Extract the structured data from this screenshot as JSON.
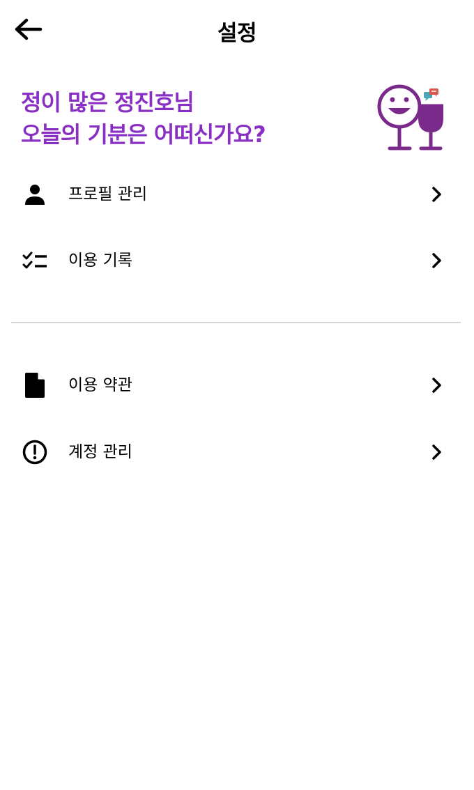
{
  "header": {
    "title": "설정",
    "back_icon": "arrow-left-icon"
  },
  "greeting": {
    "line1": "정이 많은 정진호님",
    "line2": "오늘의 기분은 어떠신가요?",
    "color": "#8a2fc3"
  },
  "menu": {
    "section1": [
      {
        "label": "프로필 관리",
        "icon": "person-icon"
      },
      {
        "label": "이용 기록",
        "icon": "checklist-icon"
      }
    ],
    "section2": [
      {
        "label": "이용 약관",
        "icon": "document-icon"
      },
      {
        "label": "계정 관리",
        "icon": "alert-circle-icon"
      }
    ]
  },
  "colors": {
    "accent": "#8a2fc3",
    "wine": "#7a2a8a",
    "divider": "#d6d6d6"
  }
}
